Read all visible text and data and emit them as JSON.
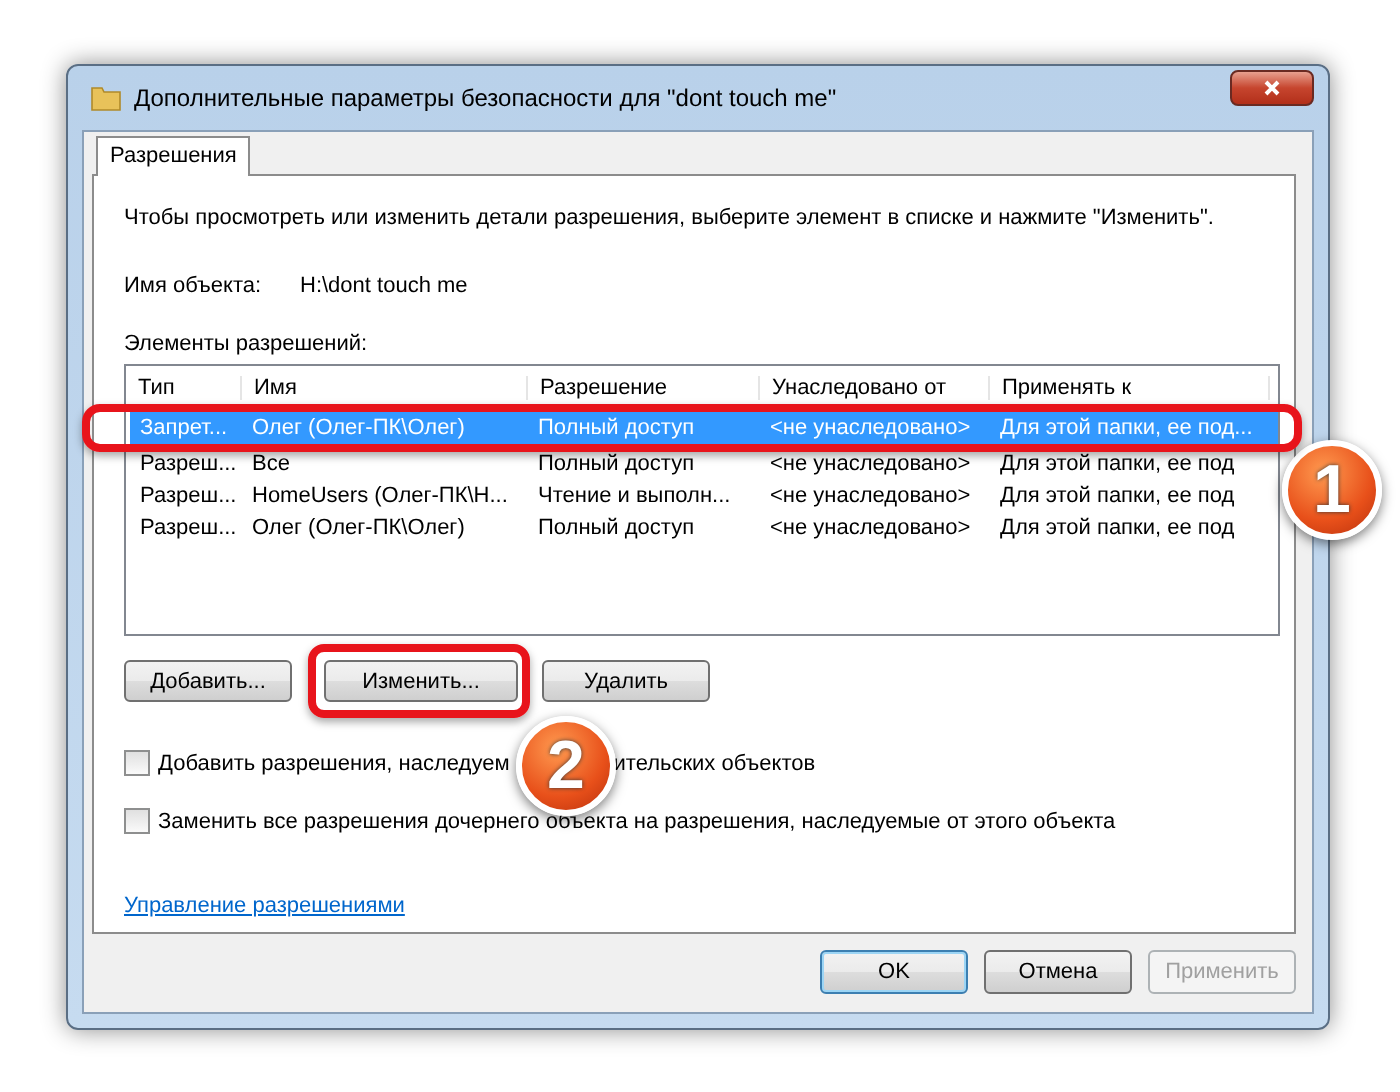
{
  "window": {
    "title": "Дополнительные параметры безопасности  для \"dont touch me\""
  },
  "tabs": [
    {
      "label": "Разрешения",
      "selected": true
    }
  ],
  "instructions": "Чтобы просмотреть или изменить детали разрешения, выберите элемент в списке и нажмите \"Изменить\".",
  "object_name": {
    "label": "Имя объекта:",
    "value": "H:\\dont touch me"
  },
  "list": {
    "label": "Элементы разрешений:",
    "columns": [
      "Тип",
      "Имя",
      "Разрешение",
      "Унаследовано от",
      "Применять к"
    ],
    "rows": [
      {
        "cells": [
          "Запрет...",
          "Олег (Олег-ПК\\Олег)",
          "Полный доступ",
          "<не унаследовано>",
          "Для этой папки, ее под..."
        ],
        "selected": true,
        "annotated": true
      },
      {
        "cells": [
          "Разреш...",
          "Все",
          "Полный доступ",
          "<не унаследовано>",
          "Для этой папки, ее под"
        ],
        "selected": false,
        "annotated": false
      },
      {
        "cells": [
          "Разреш...",
          "HomeUsers (Олег-ПК\\Н...",
          "Чтение и выполн...",
          "<не унаследовано>",
          "Для этой папки, ее под"
        ],
        "selected": false,
        "annotated": false
      },
      {
        "cells": [
          "Разреш...",
          "Олег (Олег-ПК\\Олег)",
          "Полный доступ",
          "<не унаследовано>",
          "Для этой папки, ее под"
        ],
        "selected": false,
        "annotated": false
      }
    ]
  },
  "buttons": [
    {
      "label": "Добавить...",
      "annotated": false
    },
    {
      "label": "Изменить...",
      "annotated": true
    },
    {
      "label": "Удалить",
      "annotated": false
    }
  ],
  "checkboxes": [
    {
      "label_parts": [
        "Добавить разрешения, наследуем",
        "ительских объектов"
      ],
      "checked": false
    },
    {
      "label_parts": [
        "Заменить все разрешения дочернего объекта на разрешения, наследуемые от этого объекта"
      ],
      "checked": false
    }
  ],
  "link": "Управление разрешениями",
  "dialog_buttons": [
    {
      "label": "OK",
      "default": true,
      "disabled": false
    },
    {
      "label": "Отмена",
      "default": false,
      "disabled": false
    },
    {
      "label": "Применить",
      "default": false,
      "disabled": true
    }
  ],
  "callouts": [
    "1",
    "2"
  ]
}
